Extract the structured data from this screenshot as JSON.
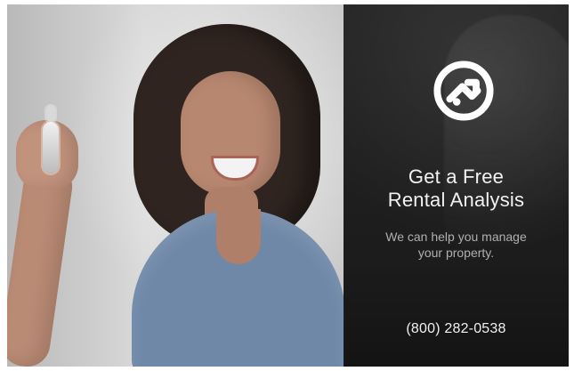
{
  "headline": {
    "line1": "Get a Free",
    "line2": "Rental Analysis"
  },
  "subheadline": {
    "line1": "We can help you manage",
    "line2": "your property."
  },
  "contact": {
    "phone": "(800) 282-0538"
  },
  "colors": {
    "logo_white": "#ffffff",
    "panel_dark": "#111111",
    "text_light": "#f2f2f2",
    "top_blue": "#6f88a8"
  },
  "icons": {
    "brand_logo": "house-in-circle-icon"
  }
}
